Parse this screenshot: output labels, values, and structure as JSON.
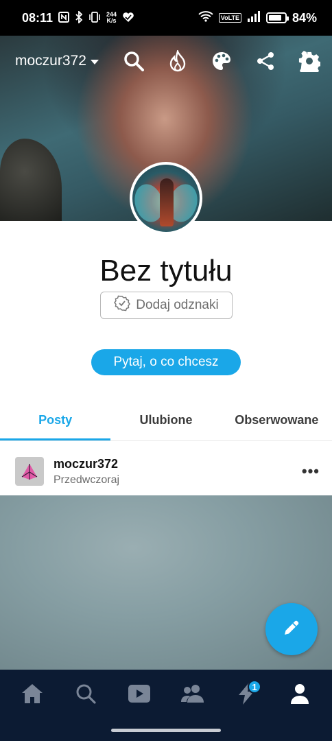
{
  "status_bar": {
    "time": "08:11",
    "net_speed_value": "244",
    "net_speed_unit": "K/s",
    "volte": "VoLTE",
    "battery_percent": "84%",
    "battery_level": 0.84
  },
  "header": {
    "account_name": "moczur372"
  },
  "profile": {
    "title": "Bez tytułu",
    "badges_button": "Dodaj odznaki",
    "ask_button": "Pytaj, o co chcesz"
  },
  "tabs": [
    {
      "label": "Posty",
      "active": true
    },
    {
      "label": "Ulubione",
      "active": false
    },
    {
      "label": "Obserwowane",
      "active": false
    }
  ],
  "post": {
    "username": "moczur372",
    "timestamp": "Przedwczoraj",
    "more": "•••"
  },
  "bottom_nav": {
    "items": [
      "home-icon",
      "search-icon",
      "video-icon",
      "people-icon",
      "activity-icon",
      "profile-icon"
    ],
    "activity_badge": "1",
    "active": "profile-icon"
  },
  "colors": {
    "accent": "#1aa7e8",
    "nav_bg": "#0c1b33"
  }
}
